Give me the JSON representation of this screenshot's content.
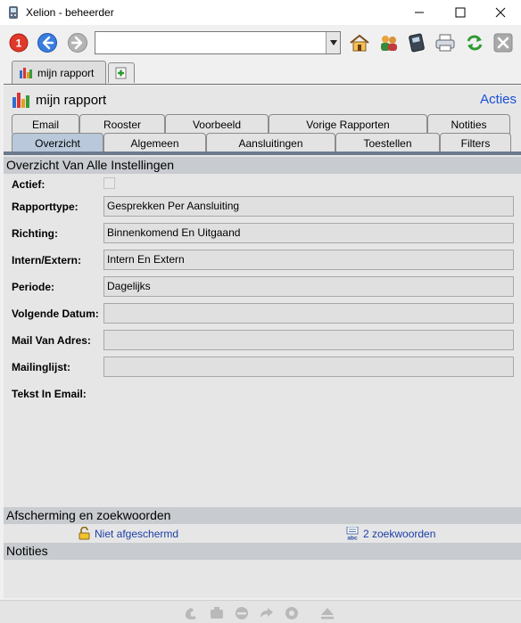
{
  "window": {
    "title": "Xelion - beheerder"
  },
  "toolbar": {
    "address_value": "",
    "address_placeholder": ""
  },
  "doc_tab": {
    "label": "mijn rapport"
  },
  "report": {
    "title": "mijn rapport",
    "acties_label": "Acties"
  },
  "tabs": {
    "row1": [
      "Email",
      "Rooster",
      "Voorbeeld",
      "Vorige Rapporten",
      "Notities"
    ],
    "row2": [
      "Overzicht",
      "Algemeen",
      "Aansluitingen",
      "Toestellen",
      "Filters"
    ],
    "active": "Overzicht"
  },
  "overview": {
    "heading": "Overzicht Van Alle Instellingen",
    "fields": [
      {
        "label": "Actief:",
        "value": ""
      },
      {
        "label": "Rapporttype:",
        "value": "Gesprekken Per Aansluiting"
      },
      {
        "label": "Richting:",
        "value": "Binnenkomend En Uitgaand"
      },
      {
        "label": "Intern/Extern:",
        "value": "Intern En Extern"
      },
      {
        "label": "Periode:",
        "value": "Dagelijks"
      },
      {
        "label": "Volgende Datum:",
        "value": ""
      },
      {
        "label": "Mail Van Adres:",
        "value": ""
      },
      {
        "label": "Mailinglijst:",
        "value": ""
      },
      {
        "label": "Tekst In Email:",
        "value": ""
      }
    ]
  },
  "protection": {
    "heading": "Afscherming en zoekwoorden",
    "shield_label": "Niet afgeschermd",
    "keywords_label": "2 zoekwoorden"
  },
  "notes": {
    "heading": "Notities"
  },
  "colors": {
    "accent": "#1a4fd6",
    "active_tab": "#b9c8da",
    "section_bar": "#c8cbcf"
  }
}
